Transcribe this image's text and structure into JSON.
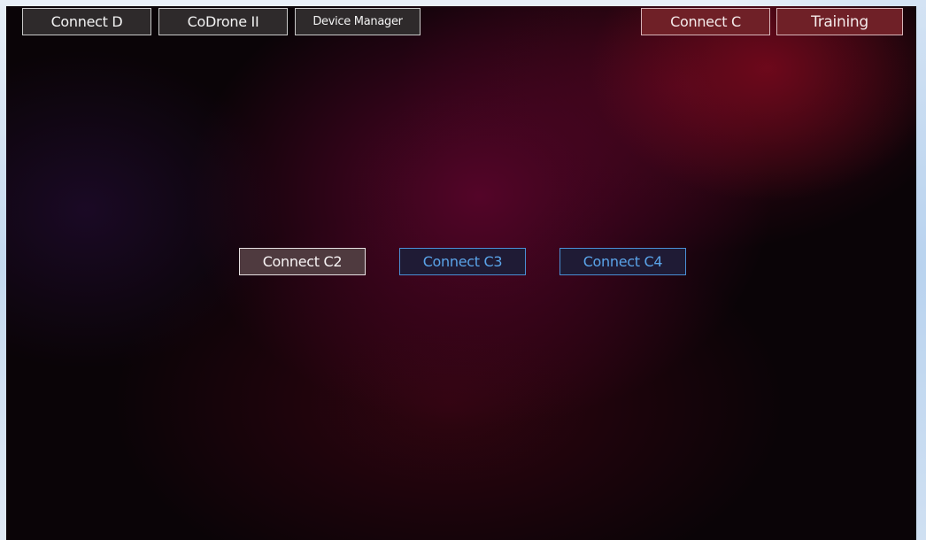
{
  "top_bar": {
    "left_buttons": [
      {
        "label": "Connect D"
      },
      {
        "label": "CoDrone II"
      },
      {
        "label": "Device Manager"
      }
    ],
    "right_buttons": [
      {
        "label": "Connect C"
      },
      {
        "label": "Training"
      }
    ]
  },
  "center_buttons": [
    {
      "label": "Connect C2"
    },
    {
      "label": "Connect C3"
    },
    {
      "label": "Connect C4"
    }
  ],
  "colors": {
    "background_dark": "#0a0407",
    "background_accent": "#58052a",
    "top_button_dark": "#2e2a2b",
    "top_button_red": "#6f2027",
    "blue_text": "#5aa3e8",
    "blue_border": "#4a8fd4"
  }
}
